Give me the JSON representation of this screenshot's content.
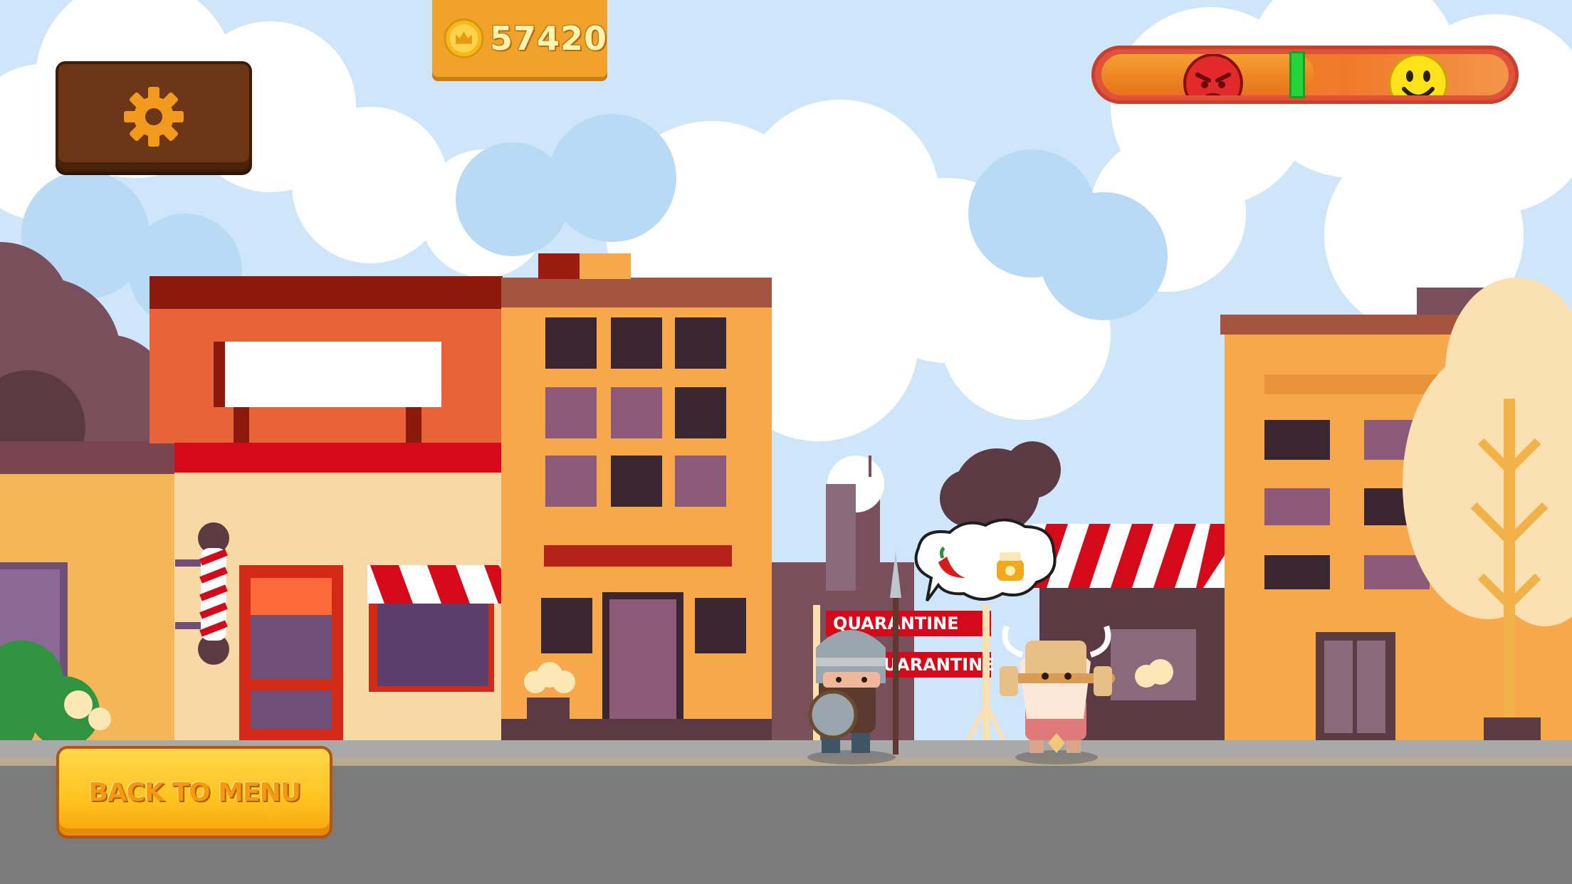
{
  "hud": {
    "coins": "57420",
    "back_label": "BACK TO MENU",
    "settings_icon": "gear-icon",
    "mood_level": 0.48
  },
  "scene": {
    "sign_text_1": "QUARANTINE",
    "sign_text_2": "QUARANTINE"
  },
  "customer_request": {
    "items": [
      "chili-pepper-icon",
      "honey-jar-icon"
    ]
  },
  "colors": {
    "sky": "#cfe6fa",
    "road": "#7b7b7b",
    "accent_orange": "#f0a22a",
    "settings_brown": "#6b3516",
    "button_yellow": "#ffc21f"
  }
}
